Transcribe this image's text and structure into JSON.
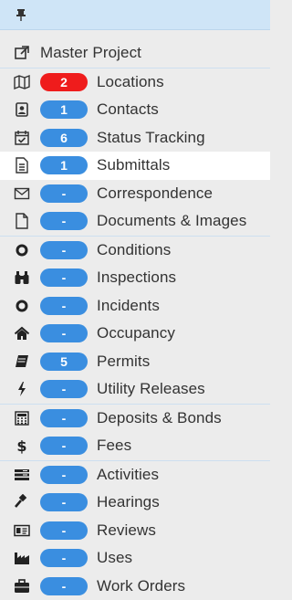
{
  "master": {
    "label": "Master Project"
  },
  "items": [
    {
      "icon": "map-icon",
      "badge": "2",
      "label": "Locations"
    },
    {
      "icon": "contact-card-icon",
      "badge": "1",
      "label": "Contacts"
    },
    {
      "icon": "calendar-check-icon",
      "badge": "6",
      "label": "Status Tracking"
    },
    {
      "icon": "document-list-icon",
      "badge": "1",
      "label": "Submittals"
    },
    {
      "icon": "envelope-icon",
      "badge": "-",
      "label": "Correspondence"
    },
    {
      "icon": "file-icon",
      "badge": "-",
      "label": "Documents & Images"
    },
    {
      "icon": "ring-icon",
      "badge": "-",
      "label": "Conditions"
    },
    {
      "icon": "binoculars-icon",
      "badge": "-",
      "label": "Inspections"
    },
    {
      "icon": "ring-icon",
      "badge": "-",
      "label": "Incidents"
    },
    {
      "icon": "home-icon",
      "badge": "-",
      "label": "Occupancy"
    },
    {
      "icon": "book-icon",
      "badge": "5",
      "label": "Permits"
    },
    {
      "icon": "bolt-icon",
      "badge": "-",
      "label": "Utility Releases"
    },
    {
      "icon": "calculator-icon",
      "badge": "-",
      "label": "Deposits & Bonds"
    },
    {
      "icon": "dollar-icon",
      "badge": "-",
      "label": "Fees"
    },
    {
      "icon": "activities-icon",
      "badge": "-",
      "label": "Activities"
    },
    {
      "icon": "gavel-icon",
      "badge": "-",
      "label": "Hearings"
    },
    {
      "icon": "id-card-icon",
      "badge": "-",
      "label": "Reviews"
    },
    {
      "icon": "factory-icon",
      "badge": "-",
      "label": "Uses"
    },
    {
      "icon": "briefcase-icon",
      "badge": "-",
      "label": "Work Orders"
    }
  ],
  "colors": {
    "badge_blue": "#3a8ee0",
    "badge_red": "#ef1c1c",
    "active_row": "#ffffff",
    "header_bg": "#cfe5f7"
  }
}
